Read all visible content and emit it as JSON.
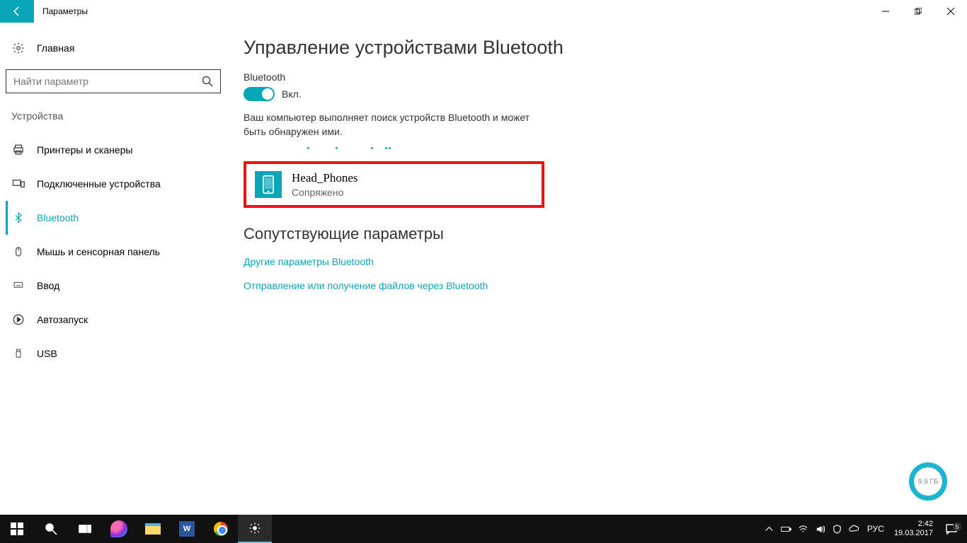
{
  "window": {
    "title": "Параметры"
  },
  "home": {
    "label": "Главная"
  },
  "search": {
    "placeholder": "Найти параметр"
  },
  "section": "Устройства",
  "nav": [
    {
      "label": "Принтеры и сканеры"
    },
    {
      "label": "Подключенные устройства"
    },
    {
      "label": "Bluetooth"
    },
    {
      "label": "Мышь и сенсорная панель"
    },
    {
      "label": "Ввод"
    },
    {
      "label": "Автозапуск"
    },
    {
      "label": "USB"
    }
  ],
  "page": {
    "title": "Управление устройствами Bluetooth",
    "toggle_label": "Bluetooth",
    "toggle_state": "Вкл.",
    "status": "Ваш компьютер выполняет поиск устройств Bluetooth и может быть обнаружен ими."
  },
  "device": {
    "name": "Head_Phones",
    "status": "Сопряжено"
  },
  "related": {
    "heading": "Сопутствующие параметры",
    "link1": "Другие параметры Bluetooth",
    "link2": "Отправление или получение файлов через Bluetooth"
  },
  "badge": "9.9 ГБ",
  "taskbar": {
    "word": "W",
    "lang": "РУС",
    "time": "2:42",
    "date": "19.03.2017",
    "notif_count": "5"
  }
}
